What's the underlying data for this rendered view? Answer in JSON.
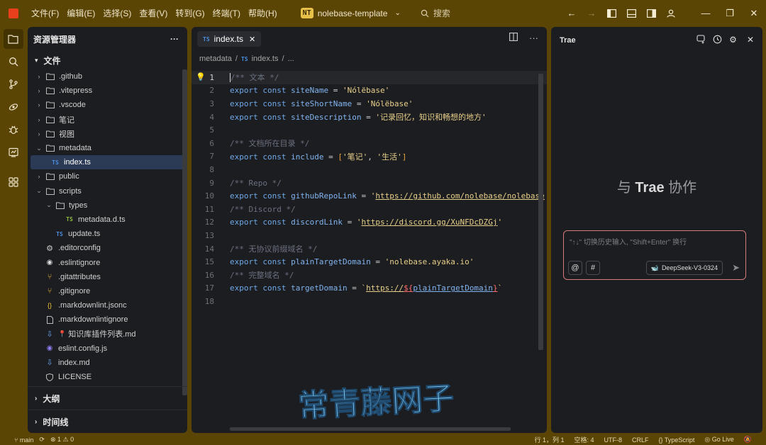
{
  "titlebar": {
    "menu": [
      "文件(F)",
      "编辑(E)",
      "选择(S)",
      "查看(V)",
      "转到(G)",
      "终端(T)",
      "帮助(H)"
    ],
    "project_badge": "NT",
    "project_name": "nolebase-template",
    "search_placeholder": "搜索"
  },
  "explorer": {
    "header": "资源管理器",
    "section_files": "文件",
    "items": [
      {
        "label": ".github"
      },
      {
        "label": ".vitepress"
      },
      {
        "label": ".vscode"
      },
      {
        "label": "笔记"
      },
      {
        "label": "视图"
      },
      {
        "label": "metadata"
      },
      {
        "label": "index.ts"
      },
      {
        "label": "public"
      },
      {
        "label": "scripts"
      },
      {
        "label": "types"
      },
      {
        "label": "metadata.d.ts"
      },
      {
        "label": "update.ts"
      },
      {
        "label": ".editorconfig"
      },
      {
        "label": ".eslintignore"
      },
      {
        "label": ".gitattributes"
      },
      {
        "label": ".gitignore"
      },
      {
        "label": ".markdownlint.jsonc"
      },
      {
        "label": ".markdownlintignore"
      },
      {
        "label": "知识库插件列表.md"
      },
      {
        "label": "eslint.config.js"
      },
      {
        "label": "index.md"
      },
      {
        "label": "LICENSE"
      }
    ],
    "ts_badge": "TS",
    "json_badge": "{}",
    "section_outline": "大纲",
    "section_timeline": "时间线"
  },
  "editor": {
    "tab_label": "index.ts",
    "tab_badge": "TS",
    "breadcrumb": [
      "metadata",
      "index.ts",
      "..."
    ],
    "line_numbers": [
      "1",
      "2",
      "3",
      "4",
      "5",
      "6",
      "7",
      "8",
      "9",
      "10",
      "11",
      "12",
      "13",
      "14",
      "15",
      "16",
      "17",
      "18"
    ]
  },
  "code": {
    "c1": "/** 文本 */",
    "export": "export",
    "const": "const",
    "siteName": "siteName",
    "siteName_val": "'Nólëbase'",
    "siteShortName": "siteShortName",
    "siteShortName_val": "'Nólëbase'",
    "siteDescription": "siteDescription",
    "siteDescription_val": "'记录回忆，知识和畅想的地方'",
    "c6": "/** 文档所在目录 */",
    "include": "include",
    "include_v1": "'笔记'",
    "include_v2": "'生活'",
    "c9": "/** Repo */",
    "githubRepoLink": "githubRepoLink",
    "githubRepoLink_url": "https://github.com/nolebase/nolebase",
    "c11": "/** Discord */",
    "discordLink": "discordLink",
    "discordLink_url": "https://discord.gg/XuNFDcDZGj",
    "c14": "/** 无协议前缀域名 */",
    "plainTargetDomain": "plainTargetDomain",
    "plainTargetDomain_val": "'nolebase.ayaka.io'",
    "c16": "/** 完整域名 */",
    "targetDomain": "targetDomain",
    "targetDomain_prefix": "https://",
    "targetDomain_expr": "plainTargetDomain"
  },
  "chat": {
    "title": "Trae",
    "hero_prefix": "与",
    "hero_brand": "Trae",
    "hero_suffix": "协作",
    "placeholder": "\"↑↓\" 切换历史输入, \"Shift+Enter\" 换行",
    "at_label": "@",
    "hash_label": "#",
    "model": "DeepSeek-V3-0324"
  },
  "watermark": {
    "text": "常青藤网子"
  },
  "statusbar": {
    "branch": "main",
    "errors": "1",
    "warnings": "0",
    "position": "行 1，列 1",
    "spaces": "空格: 4",
    "encoding": "UTF-8",
    "eol": "CRLF",
    "language": "TypeScript",
    "golive": "Go Live"
  },
  "colors": {
    "titlebar_bg": "#5a4505",
    "panel_bg": "#1c1d20",
    "accent": "#e8401c",
    "chat_input_border": "#d77b7b",
    "watermark": "#7ec8f0"
  }
}
